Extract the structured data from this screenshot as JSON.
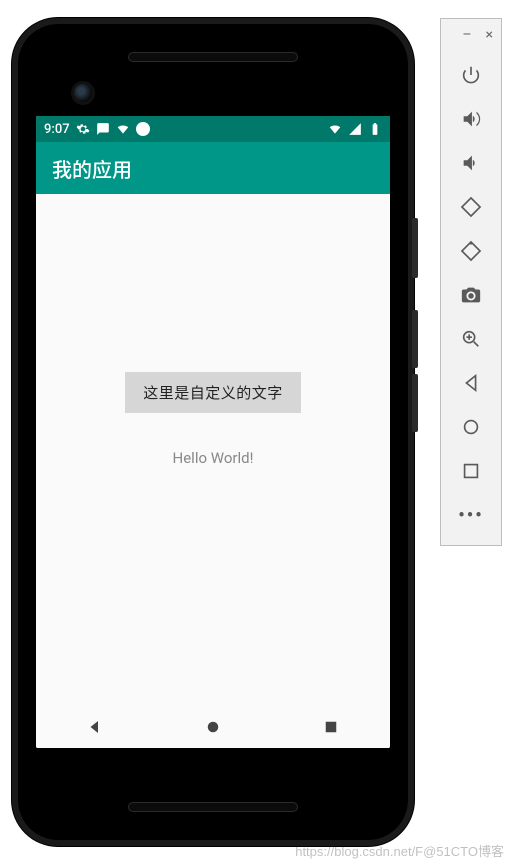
{
  "statusbar": {
    "time": "9:07",
    "icons_left": [
      "gear-icon",
      "message-icon",
      "wifi-icon",
      "dot-icon"
    ],
    "icons_right": [
      "wifi-icon",
      "signal-icon",
      "battery-icon"
    ]
  },
  "appbar": {
    "title": "我的应用"
  },
  "content": {
    "button_label": "这里是自定义的文字",
    "hello_text": "Hello World!"
  },
  "navbar": {
    "back": "back",
    "home": "home",
    "recents": "recents"
  },
  "emulator_toolbar": {
    "window_controls": {
      "minimize": "–",
      "close": "×"
    },
    "buttons": [
      {
        "name": "power-icon"
      },
      {
        "name": "volume-up-icon"
      },
      {
        "name": "volume-down-icon"
      },
      {
        "name": "rotate-left-icon"
      },
      {
        "name": "rotate-right-icon"
      },
      {
        "name": "camera-icon"
      },
      {
        "name": "zoom-icon"
      },
      {
        "name": "back-icon"
      },
      {
        "name": "home-icon"
      },
      {
        "name": "overview-icon"
      },
      {
        "name": "more-icon"
      }
    ]
  },
  "watermark": "https://blog.csdn.net/F@51CTO博客"
}
